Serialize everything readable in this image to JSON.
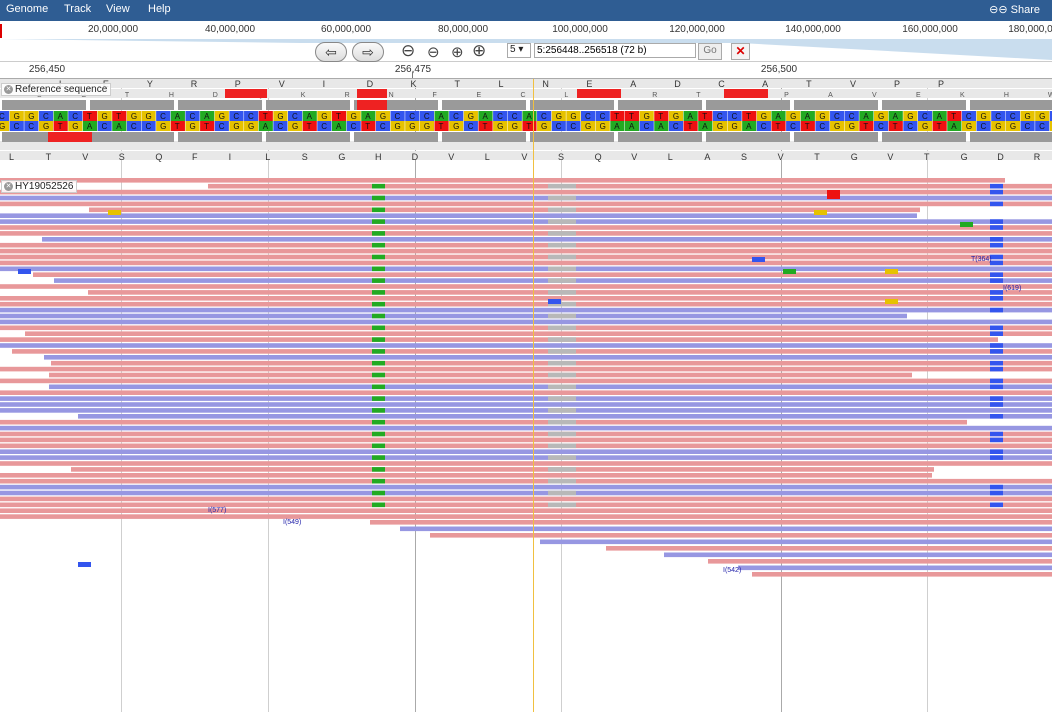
{
  "menu": {
    "items": [
      "Genome",
      "Track",
      "View",
      "Help"
    ],
    "share_label": "Share"
  },
  "overview": {
    "labels": [
      "20,000,000",
      "40,000,000",
      "60,000,000",
      "80,000,000",
      "100,000,000",
      "120,000,000",
      "140,000,000",
      "160,000,000",
      "180,000,000"
    ]
  },
  "navigation": {
    "back_icon": "arrow-left-icon",
    "forward_icon": "arrow-right-icon",
    "zoom_icons": [
      "zoom-out-max-icon",
      "zoom-out-icon",
      "zoom-in-icon",
      "zoom-in-max-icon"
    ],
    "chromosome": "5 ▾",
    "location": "5:256448..256518 (72 b)",
    "go_label": "Go"
  },
  "scale": {
    "labels": [
      "256,450",
      "256,475",
      "256,500"
    ]
  },
  "tracks": {
    "reference_label": "Reference sequence",
    "reads_label": "HY19052526"
  },
  "colors": {
    "A": "#22aa22",
    "C": "#3355ee",
    "G": "#e6c200",
    "T": "#ee1111",
    "read_fwd": "#e8989a",
    "read_rev": "#9797e2",
    "menu_bg": "#2f5d93"
  },
  "reference": {
    "dna": "CGGCACTGTGGCACAGCCTGCAGTGAGCCCACGACCACGGCCTTGTGATCCTGAGAGCCAGAGCATCGCCGGCCAC",
    "aa_top": [
      "",
      "L",
      "E",
      "Y",
      "R",
      "P",
      "V",
      "I",
      "D",
      "K",
      "T",
      "L",
      "N",
      "E",
      "A",
      "D",
      "C",
      "A",
      "T",
      "V",
      "P",
      "P"
    ],
    "aa_bottom": [
      "L",
      "T",
      "V",
      "S",
      "Q",
      "F",
      "I",
      "L",
      "S",
      "G",
      "H",
      "D",
      "V",
      "L",
      "V",
      "S",
      "Q",
      "V",
      "L",
      "A",
      "S",
      "V",
      "T",
      "G",
      "V",
      "T",
      "G",
      "D",
      "R",
      "W"
    ]
  },
  "annotations": [
    "T(364)",
    "I(619)",
    "I(577)",
    "I(549)",
    "I(542)"
  ]
}
